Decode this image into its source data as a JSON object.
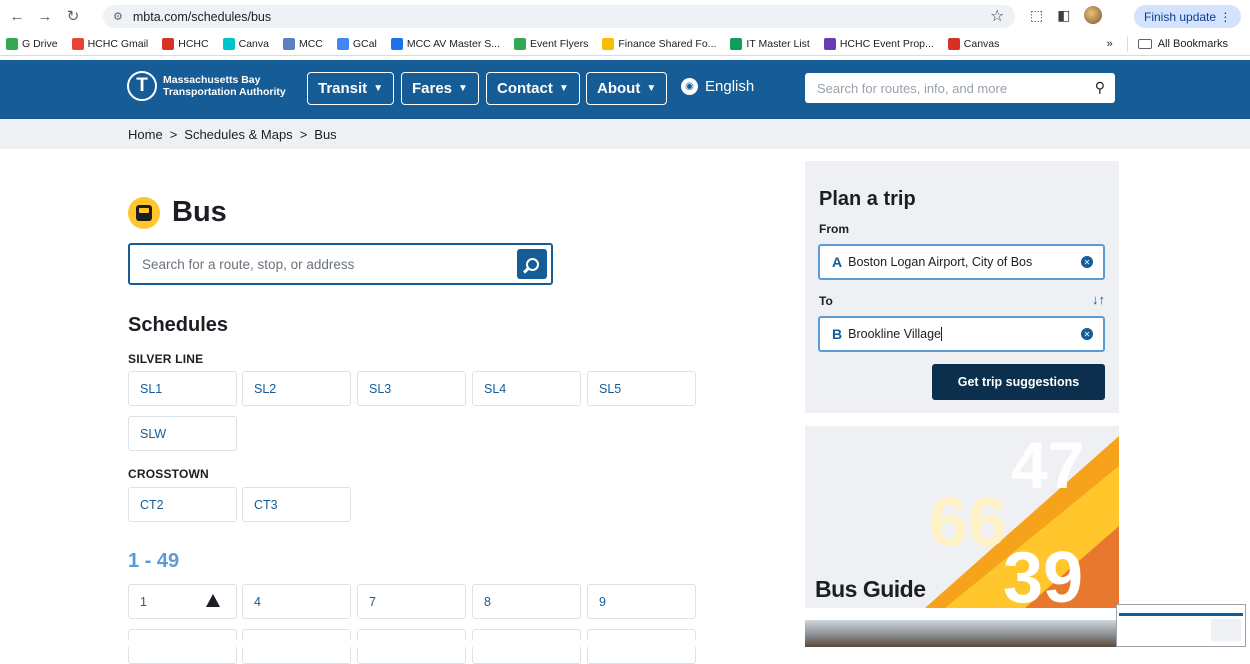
{
  "browser": {
    "url": "mbta.com/schedules/bus",
    "finish_update": "Finish update",
    "bookmarks": [
      {
        "label": "G Drive",
        "color": "#34a853"
      },
      {
        "label": "HCHC Gmail",
        "color": "#ea4335"
      },
      {
        "label": "HCHC",
        "color": "#d93025"
      },
      {
        "label": "Canva",
        "color": "#00c4cc"
      },
      {
        "label": "MCC",
        "color": "#5b7fbf"
      },
      {
        "label": "GCal",
        "color": "#4285f4"
      },
      {
        "label": "MCC AV Master S...",
        "color": "#1a73e8"
      },
      {
        "label": "Event Flyers",
        "color": "#34a853"
      },
      {
        "label": "Finance Shared Fo...",
        "color": "#fbbc04"
      },
      {
        "label": "IT Master List",
        "color": "#0f9d58"
      },
      {
        "label": "HCHC Event Prop...",
        "color": "#673ab7"
      },
      {
        "label": "Canvas",
        "color": "#d93025"
      }
    ],
    "more": "»",
    "all_bookmarks": "All Bookmarks"
  },
  "header": {
    "logo_line1": "Massachusetts Bay",
    "logo_line2": "Transportation Authority",
    "nav": [
      "Transit",
      "Fares",
      "Contact",
      "About"
    ],
    "language": "English",
    "search_placeholder": "Search for routes, info, and more"
  },
  "breadcrumb": {
    "home": "Home",
    "maps": "Schedules & Maps",
    "current": "Bus",
    "sep": ">"
  },
  "main": {
    "title": "Bus",
    "search_placeholder": "Search for a route, stop, or address",
    "schedules_heading": "Schedules",
    "silver_line_label": "SILVER LINE",
    "silver_line": [
      "SL1",
      "SL2",
      "SL3",
      "SL4",
      "SL5",
      "SLW"
    ],
    "crosstown_label": "CROSSTOWN",
    "crosstown": [
      "CT2",
      "CT3"
    ],
    "range_heading": "1 - 49",
    "routes_1_49": [
      "1",
      "4",
      "7",
      "8",
      "9"
    ]
  },
  "trip": {
    "title": "Plan a trip",
    "from_label": "From",
    "to_label": "To",
    "from_letter": "A",
    "from_value": "Boston Logan Airport, City of Bos",
    "to_letter": "B",
    "to_value": "Brookline Village",
    "submit": "Get trip suggestions"
  },
  "guide": {
    "title": "Bus Guide",
    "numbers": [
      "47",
      "66",
      "39"
    ]
  }
}
